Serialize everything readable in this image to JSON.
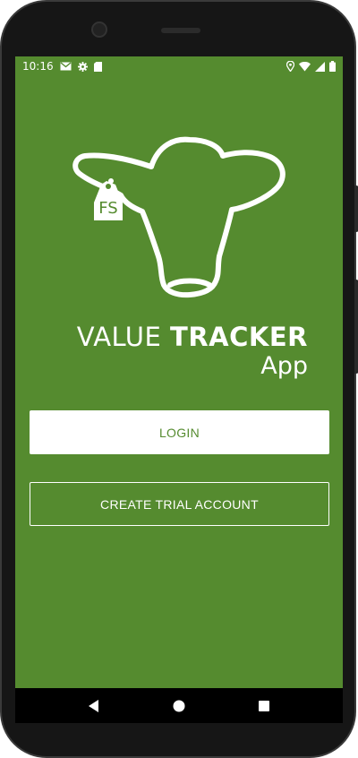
{
  "status_bar": {
    "time": "10:16",
    "left_icons": [
      "mail-icon",
      "gear-icon",
      "sim-card-icon"
    ],
    "right_icons": [
      "location-icon",
      "wifi-icon",
      "signal-icon",
      "battery-icon"
    ]
  },
  "branding": {
    "logo_icon": "cow-head-with-ear-tag-icon",
    "logo_tag_text": "FS",
    "title_light": "VALUE",
    "title_bold": "TRACKER",
    "subtitle": "App"
  },
  "buttons": {
    "login_label": "LOGIN",
    "create_trial_label": "CREATE TRIAL ACCOUNT"
  },
  "navigation": {
    "back_icon": "back-triangle-icon",
    "home_icon": "home-circle-icon",
    "recents_icon": "recents-square-icon"
  },
  "colors": {
    "background": "#558b2f",
    "primary_text": "#ffffff",
    "login_text": "#558b2f"
  }
}
